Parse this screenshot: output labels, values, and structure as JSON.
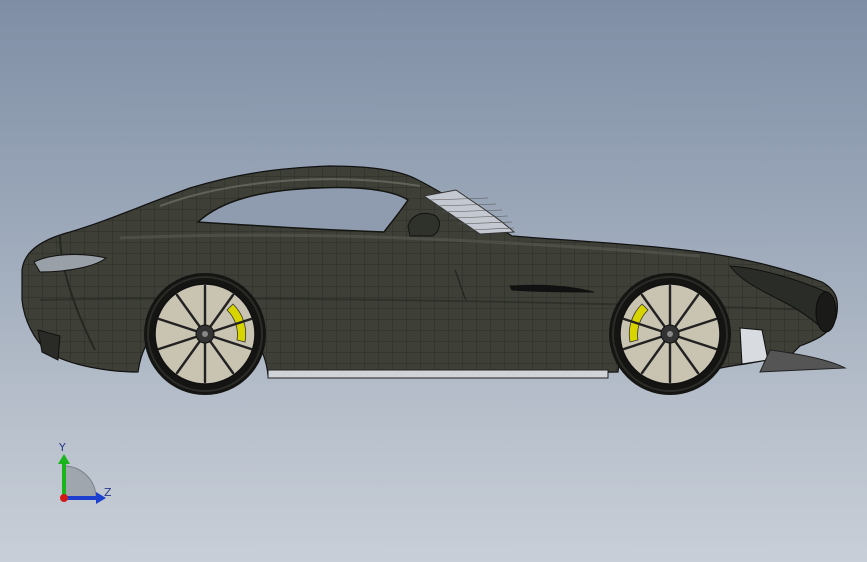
{
  "viewport": {
    "background_top": "#7f8ea5",
    "background_bottom": "#c9cfd8"
  },
  "model": {
    "body_color": "#3e4038",
    "mesh_line_color": "#1e201c",
    "caliper_color": "#d8d400",
    "rim_color": "#c9c3b2"
  },
  "triad": {
    "y_label": "Y",
    "z_label": "Z",
    "x_color": "#d21919",
    "y_color": "#1bb51b",
    "z_color": "#1d3fd0"
  }
}
